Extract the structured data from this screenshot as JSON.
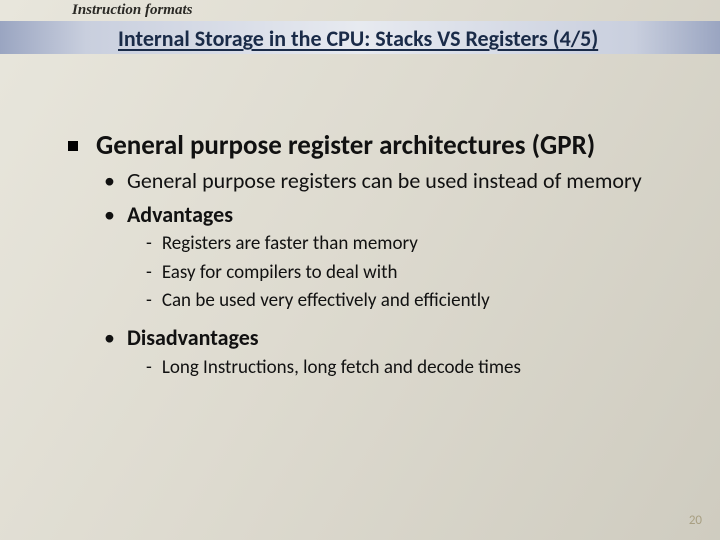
{
  "kicker": "Instruction formats",
  "title": "Internal Storage in the CPU: Stacks VS Registers (4/5)",
  "section": {
    "heading": "General purpose register architectures (GPR)",
    "items": [
      {
        "text": "General purpose registers can be used instead of memory",
        "bold": false
      },
      {
        "text": "Advantages",
        "bold": true,
        "sub": [
          "Registers are faster than memory",
          "Easy for compilers to deal with",
          "Can be used very effectively and efficiently"
        ]
      },
      {
        "text": "Disadvantages",
        "bold": true,
        "sub": [
          "Long Instructions, long fetch and decode times"
        ]
      }
    ]
  },
  "page_number": "20"
}
